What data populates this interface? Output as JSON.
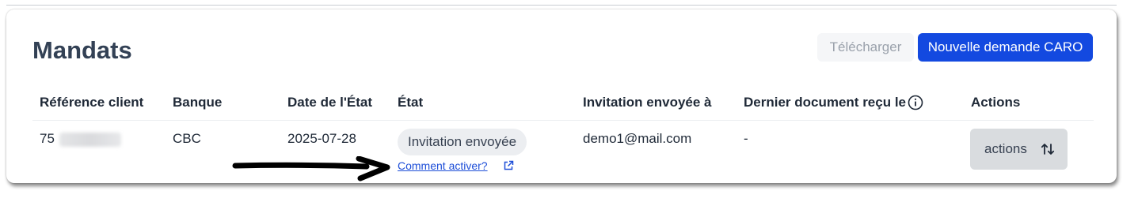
{
  "header": {
    "title": "Mandats",
    "download_label": "Télécharger",
    "new_request_label": "Nouvelle demande CARO"
  },
  "table": {
    "columns": [
      "Référence client",
      "Banque",
      "Date de l'État",
      "État",
      "Invitation envoyée à",
      "Dernier document reçu le",
      "Actions"
    ],
    "rows": [
      {
        "reference_prefix": "75",
        "bank": "CBC",
        "state_date": "2025-07-28",
        "state": "Invitation envoyée",
        "state_help_link": "Comment activer?",
        "invited_to": "demo1@mail.com",
        "last_document": "-",
        "actions_label": "actions"
      }
    ]
  },
  "icons": {
    "info": "info-circle-icon",
    "external_link": "external-link-icon",
    "sort": "sort-arrows-icon",
    "annotation": "pointer-arrow"
  },
  "colors": {
    "primary": "#1349e0",
    "link": "#1d4ed8",
    "title": "#334155",
    "badge_bg": "#eceef1",
    "actions_bg": "#d9dcdf"
  }
}
